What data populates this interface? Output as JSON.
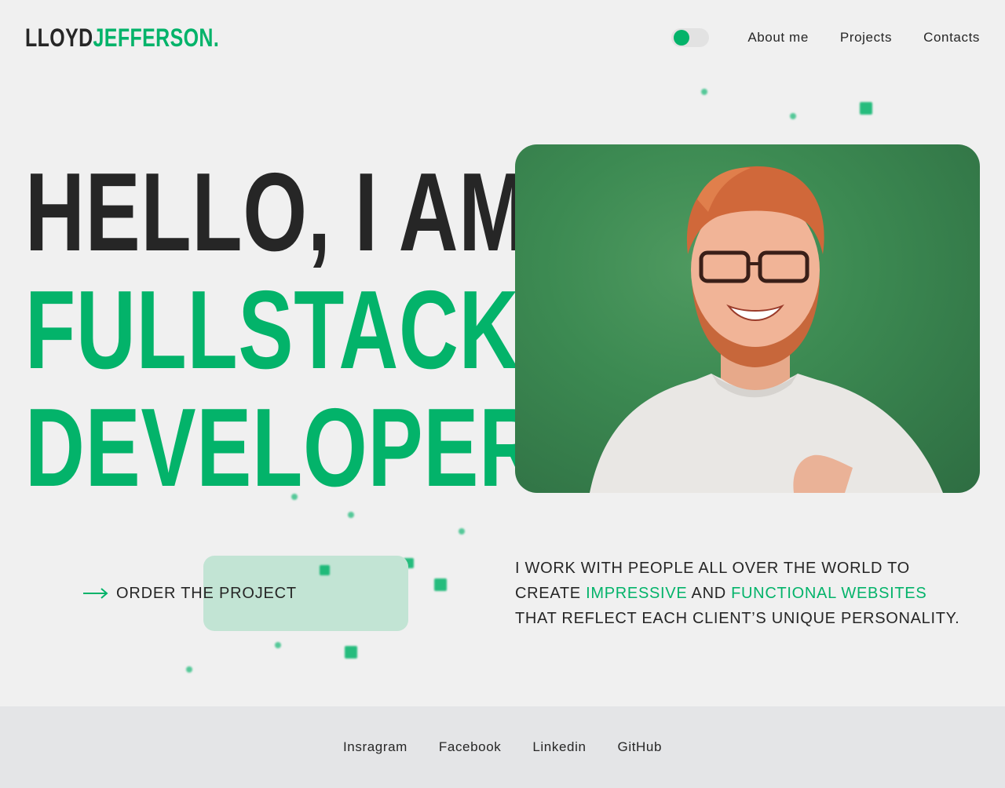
{
  "header": {
    "logo_part1": "LLOYD",
    "logo_part2": "JEFFERSON.",
    "theme_toggle": "on",
    "nav": [
      "About me",
      "Projects",
      "Contacts"
    ]
  },
  "hero": {
    "line1": "HELLO, I AM",
    "line2": "FULLSTACK",
    "line3": "DEVELOPER"
  },
  "cta": {
    "label": "ORDER THE PROJECT",
    "icon": "arrow-right-icon"
  },
  "description": {
    "part1": "I WORK WITH PEOPLE ALL OVER THE WORLD TO CREATE ",
    "accent1": "IMPRESSIVE",
    "part2": " AND ",
    "accent2": "FUNCTIONAL WEBSITES",
    "part3": " THAT REFLECT EACH CLIENT’S UNIQUE PERSONALITY."
  },
  "footer": {
    "links": [
      "Insragram",
      "Facebook",
      "Linkedin",
      "GitHub"
    ]
  },
  "colors": {
    "accent": "#03b36a",
    "text": "#262626",
    "background": "#f0f0f0",
    "footer_bg": "#e4e5e7",
    "cta_highlight": "#c2e4d4"
  }
}
